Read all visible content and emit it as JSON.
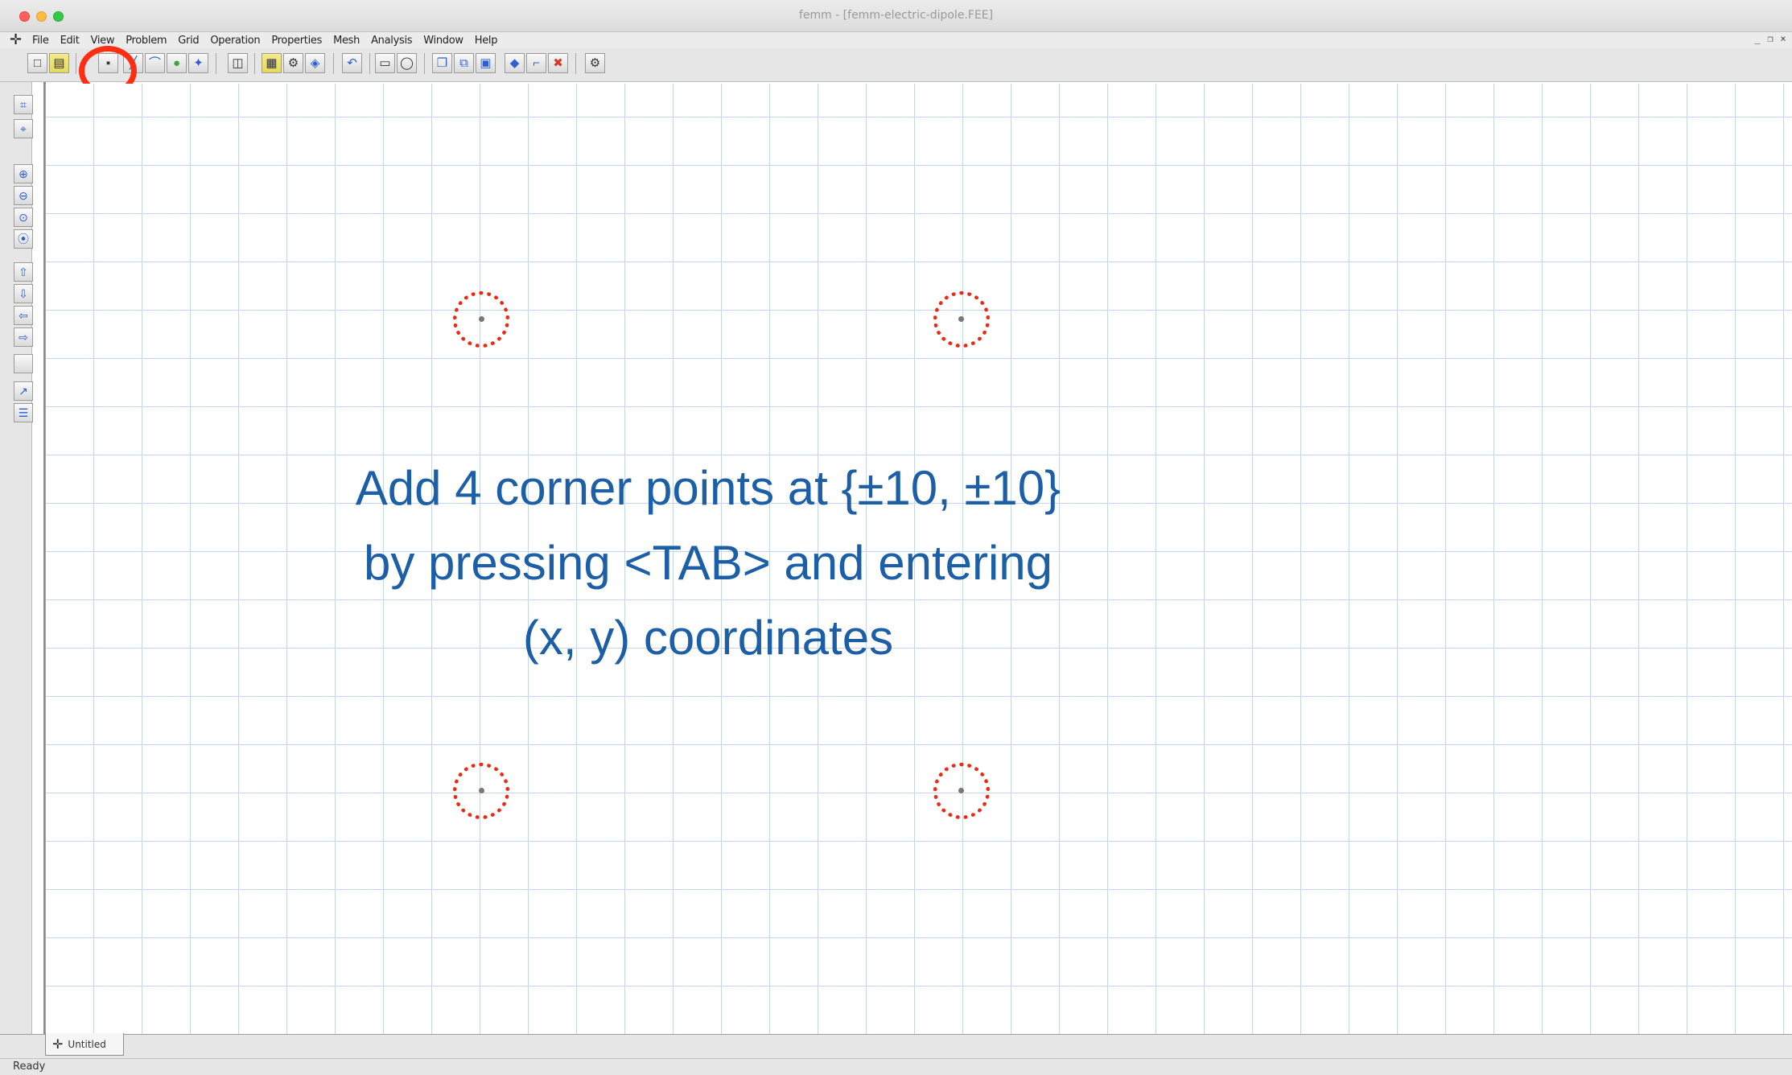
{
  "window": {
    "title": "femm - [femm-electric-dipole.FEE]"
  },
  "menubar": {
    "items": [
      "File",
      "Edit",
      "View",
      "Problem",
      "Grid",
      "Operation",
      "Properties",
      "Mesh",
      "Analysis",
      "Window",
      "Help"
    ],
    "mdi_controls": [
      "_",
      "❐",
      "×"
    ]
  },
  "toolbar": {
    "buttons": [
      {
        "name": "new-document-button",
        "icon": "□"
      },
      {
        "name": "open-file-button",
        "icon": "▤"
      },
      {
        "name": "operate-on-nodes-button",
        "icon": "▪"
      },
      {
        "name": "operate-on-segments-button",
        "icon": "╱"
      },
      {
        "name": "operate-on-arcs-button",
        "icon": "⌒"
      },
      {
        "name": "operate-on-block-labels-button",
        "icon": "●"
      },
      {
        "name": "operate-on-groups-button",
        "icon": "✦"
      },
      {
        "name": "select-window-button",
        "icon": "◫"
      },
      {
        "name": "mesh-button",
        "icon": "▦"
      },
      {
        "name": "analyze-button",
        "icon": "⚙"
      },
      {
        "name": "view-results-button",
        "icon": "◈"
      },
      {
        "name": "undo-button",
        "icon": "↶"
      },
      {
        "name": "move-button",
        "icon": "▭"
      },
      {
        "name": "rotate-button",
        "icon": "◯"
      },
      {
        "name": "copy-button",
        "icon": "❐"
      },
      {
        "name": "scale-button",
        "icon": "⧉"
      },
      {
        "name": "mirror-button",
        "icon": "▣"
      },
      {
        "name": "create-open-boundary-button",
        "icon": "◆"
      },
      {
        "name": "fillet-button",
        "icon": "⌐"
      },
      {
        "name": "delete-button",
        "icon": "✖"
      },
      {
        "name": "settings-button",
        "icon": "⚙"
      }
    ]
  },
  "lefttoolbar": {
    "buttons": [
      {
        "name": "show-grid-button",
        "icon": "⌗"
      },
      {
        "name": "snap-grid-button",
        "icon": "⌖"
      },
      {
        "name": "zoom-in-button",
        "icon": "⊕"
      },
      {
        "name": "zoom-out-button",
        "icon": "⊖"
      },
      {
        "name": "zoom-natural-button",
        "icon": "⊙"
      },
      {
        "name": "zoom-window-button",
        "icon": "⦿"
      },
      {
        "name": "pan-up-button",
        "icon": "⇧"
      },
      {
        "name": "pan-down-button",
        "icon": "⇩"
      },
      {
        "name": "pan-left-button",
        "icon": "⇦"
      },
      {
        "name": "pan-right-button",
        "icon": "⇨"
      },
      {
        "name": "blank-button",
        "icon": ""
      },
      {
        "name": "measure-button",
        "icon": "↗"
      },
      {
        "name": "properties-button",
        "icon": "☰"
      }
    ]
  },
  "canvas": {
    "instruction_lines": [
      "Add 4 corner points at {±10, ±10}",
      "by pressing <TAB> and entering",
      "(x, y) coordinates"
    ]
  },
  "tabs": {
    "document_tab": "Untitled"
  },
  "status": {
    "text": "Ready"
  },
  "colors": {
    "instruction": "#1d5fa6",
    "highlight": "#ff2d12",
    "grid": "#c7d5e9"
  }
}
